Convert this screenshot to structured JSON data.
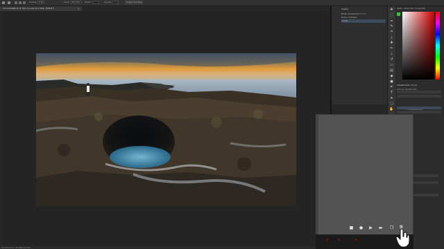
{
  "options_bar": {
    "items": [
      "Feather:",
      "0 px",
      "Style:",
      "Normal",
      "Width:",
      "Height:",
      "Select and Mask..."
    ]
  },
  "document": {
    "tab_title": "ThorsWellPlus5 @ 16% (Levels Tool Map, RGB/8*)",
    "tab_close": "×",
    "status_text": "16.67%   Doc: 55.6M/120.4M"
  },
  "layers_panel": {
    "tabs": [
      "Layers",
      "Channels",
      "Paths"
    ],
    "layers": [
      {
        "name": "Black Adjustment 1 2 3"
      },
      {
        "name": "Photo of Edges"
      },
      {
        "name": "Levels"
      }
    ]
  },
  "color_panel": {
    "tabs": [
      "Color",
      "Swatches",
      "Properties"
    ],
    "foreground": "#3fbf3f",
    "background": "#ffffff"
  },
  "adjustments_panel": {
    "tabs": [
      "Adjustments",
      "Styles"
    ],
    "label": "Add an adjustment",
    "layer_name": "ThorsWellPlus5"
  },
  "actions_panel": {
    "buttons": [
      {
        "icon": "stop-icon",
        "glyph": "■"
      },
      {
        "icon": "record-icon",
        "glyph": "●"
      },
      {
        "icon": "play-icon",
        "glyph": "▶"
      },
      {
        "icon": "folder-icon",
        "glyph": "▬"
      },
      {
        "icon": "new-action-icon",
        "glyph": "❐"
      },
      {
        "icon": "delete-icon",
        "glyph": "🗑"
      }
    ]
  },
  "tools": [
    "move",
    "marquee",
    "lasso",
    "quick-select",
    "crop",
    "eyedropper",
    "healing",
    "brush",
    "stamp",
    "history",
    "eraser",
    "gradient",
    "blur",
    "dodge",
    "pen",
    "type",
    "path-select",
    "shape",
    "hand",
    "zoom"
  ],
  "colors": {
    "accent_green": "#3fbf3f",
    "panel_bg": "#2e2e2e",
    "canvas_bg": "#242424"
  }
}
